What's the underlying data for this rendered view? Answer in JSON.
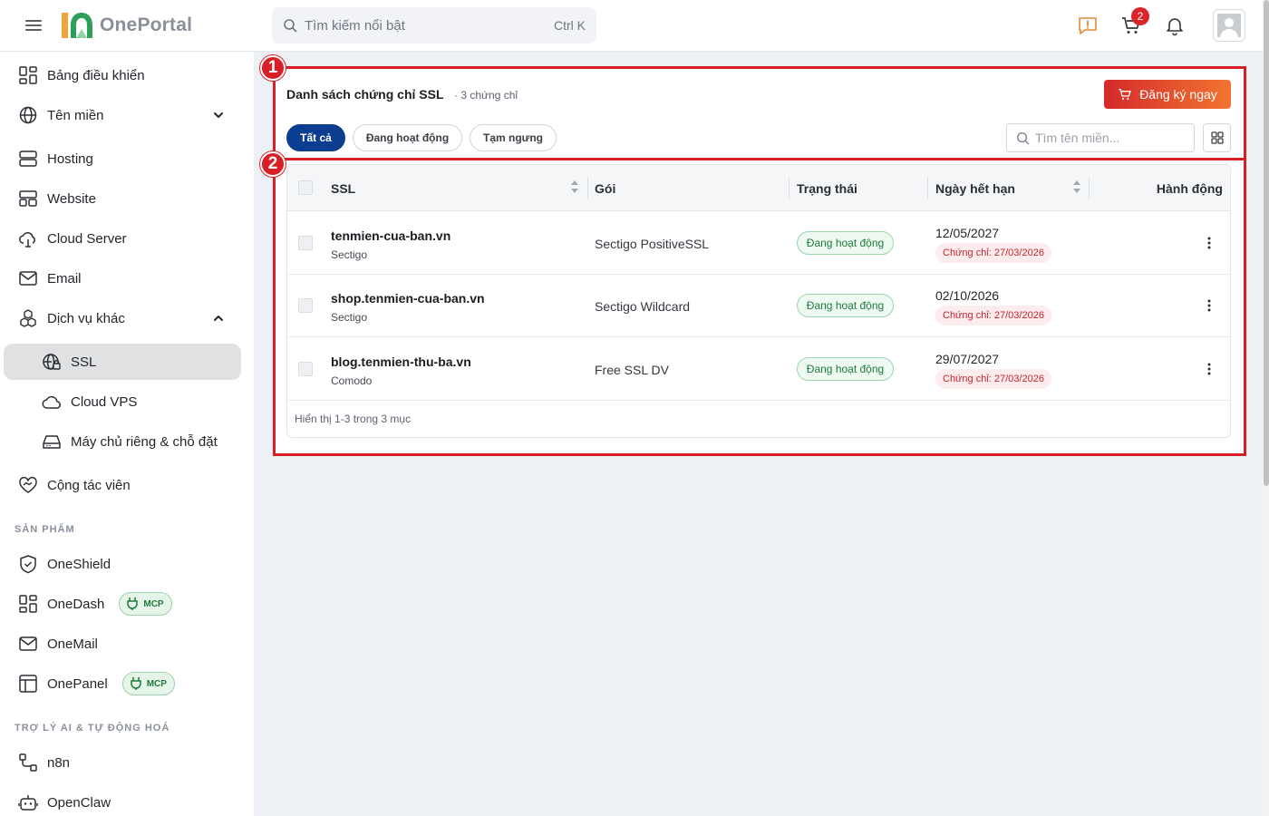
{
  "app": {
    "name": "OnePortal"
  },
  "search": {
    "placeholder": "Tìm kiếm nổi bật",
    "shortcut": "Ctrl K"
  },
  "header": {
    "cart_count": "2"
  },
  "sidebar": {
    "items": [
      {
        "label": "Bảng điều khiển",
        "icon": "dashboard-icon"
      },
      {
        "label": "Tên miền",
        "icon": "globe-icon",
        "expand": "collapsed"
      },
      {
        "label": "Hosting",
        "icon": "server-icon"
      },
      {
        "label": "Website",
        "icon": "website-icon"
      },
      {
        "label": "Cloud Server",
        "icon": "cloud-server-icon"
      },
      {
        "label": "Email",
        "icon": "mail-icon"
      },
      {
        "label": "Dịch vụ khác",
        "icon": "boxes-icon",
        "expand": "expanded"
      }
    ],
    "sub_items": [
      {
        "label": "SSL",
        "icon": "ssl-globe-icon",
        "active": true
      },
      {
        "label": "Cloud VPS",
        "icon": "cloud-icon"
      },
      {
        "label": "Máy chủ riêng & chỗ đặt",
        "icon": "hard-drive-icon"
      }
    ],
    "collab": {
      "label": "Cộng tác viên",
      "icon": "handshake-icon"
    },
    "products_heading": "SẢN PHẨM",
    "products": [
      {
        "label": "OneShield",
        "icon": "shield-icon"
      },
      {
        "label": "OneDash",
        "icon": "dashboard-icon",
        "badge": "MCP"
      },
      {
        "label": "OneMail",
        "icon": "mail-icon"
      },
      {
        "label": "OnePanel",
        "icon": "panel-icon",
        "badge": "MCP"
      }
    ],
    "ai_heading": "TRỢ LÝ AI & TỰ ĐỘNG HOÁ",
    "ai": [
      {
        "label": "n8n",
        "icon": "workflow-icon"
      },
      {
        "label": "OpenClaw",
        "icon": "bot-icon"
      }
    ]
  },
  "markers": {
    "one": "1",
    "two": "2"
  },
  "main": {
    "title": "Danh sách chứng chỉ SSL",
    "count": "· 3 chứng chỉ",
    "register_button": "Đăng ký ngay",
    "filters": [
      "Tất cả",
      "Đang hoạt động",
      "Tạm ngưng"
    ],
    "active_filter": "Tất cả",
    "domain_search_placeholder": "Tìm tên miền..."
  },
  "table": {
    "headers": {
      "ssl": "SSL",
      "plan": "Gói",
      "status": "Trạng thái",
      "expiry": "Ngày hết hạn",
      "action": "Hành động"
    },
    "rows": [
      {
        "domain": "tenmien-cua-ban.vn",
        "vendor": "Sectigo",
        "plan": "Sectigo PositiveSSL",
        "status": "Đang hoạt động",
        "expiry": "12/05/2027",
        "cert": "Chứng chỉ: 27/03/2026"
      },
      {
        "domain": "shop.tenmien-cua-ban.vn",
        "vendor": "Sectigo",
        "plan": "Sectigo Wildcard",
        "status": "Đang hoạt động",
        "expiry": "02/10/2026",
        "cert": "Chứng chỉ: 27/03/2026"
      },
      {
        "domain": "blog.tenmien-thu-ba.vn",
        "vendor": "Comodo",
        "plan": "Free SSL DV",
        "status": "Đang hoạt động",
        "expiry": "29/07/2027",
        "cert": "Chứng chỉ: 27/03/2026"
      }
    ],
    "footer": "Hiển thị 1-3 trong 3 mục"
  },
  "colors": {
    "accent_navy": "#0b3e91",
    "brand_red": "#d81f26",
    "active_green": "#1d7a3d",
    "logo_green": "#2e9e5b",
    "logo_orange": "#f0a43a"
  }
}
